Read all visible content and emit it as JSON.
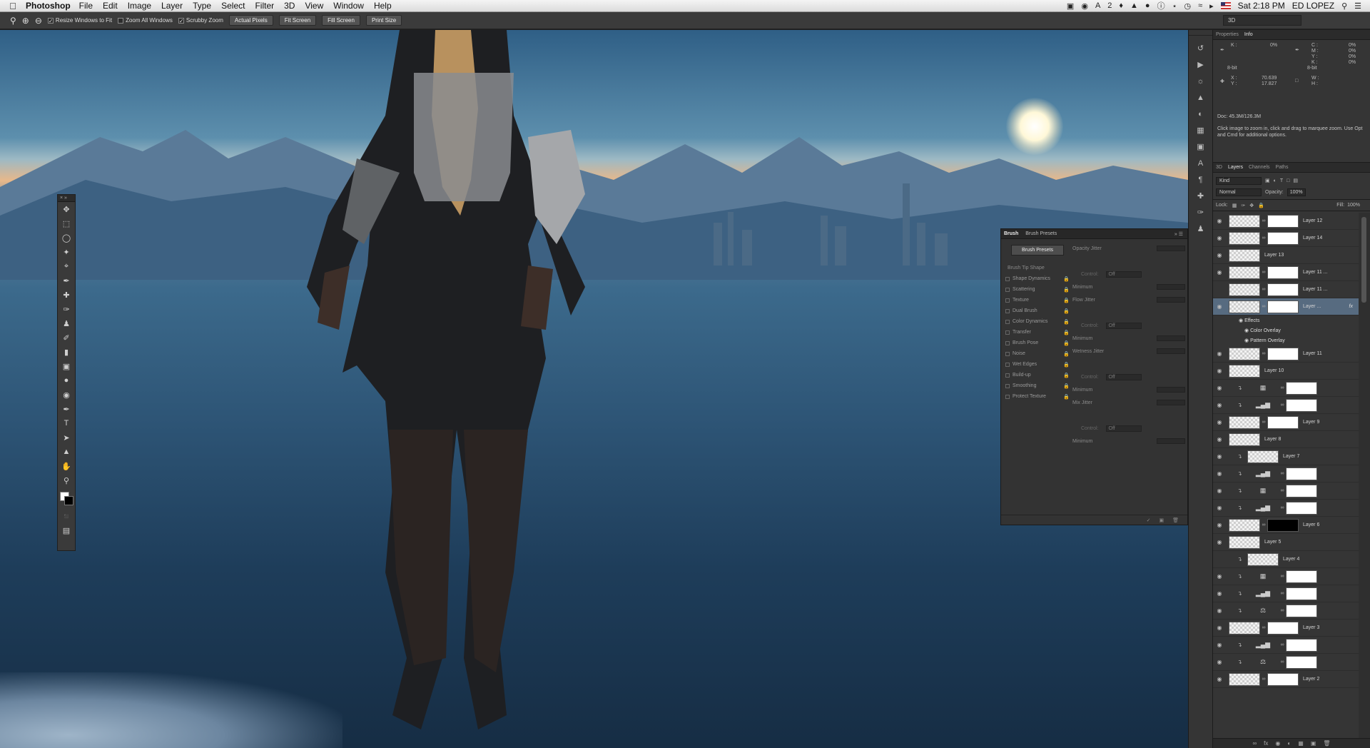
{
  "menubar": {
    "app_name": "Photoshop",
    "items": [
      "File",
      "Edit",
      "Image",
      "Layer",
      "Type",
      "Select",
      "Filter",
      "3D",
      "View",
      "Window",
      "Help"
    ],
    "status_number": "2",
    "clock": "Sat 2:18 PM",
    "user": "ED LOPEZ"
  },
  "options_bar": {
    "resize_windows": "Resize Windows to Fit",
    "zoom_all": "Zoom All Windows",
    "scrubby_zoom": "Scrubby Zoom",
    "actual_pixels": "Actual Pixels",
    "fit_screen": "Fit Screen",
    "fill_screen": "Fill Screen",
    "print_size": "Print Size",
    "workspace": "3D"
  },
  "brush_panel": {
    "tab_brush": "Brush",
    "tab_presets": "Brush Presets",
    "presets_button": "Brush Presets",
    "tip_shape": "Brush Tip Shape",
    "options": [
      "Shape Dynamics",
      "Scattering",
      "Texture",
      "Dual Brush",
      "Color Dynamics",
      "Transfer",
      "Brush Pose",
      "Noise",
      "Wet Edges",
      "Build-up",
      "Smoothing",
      "Protect Texture"
    ],
    "opacity_jitter": "Opacity Jitter",
    "flow_jitter": "Flow Jitter",
    "wetness_jitter": "Wetness Jitter",
    "mix_jitter": "Mix Jitter",
    "control": "Control:",
    "off": "Off",
    "minimum": "Minimum"
  },
  "info_panel": {
    "tab_properties": "Properties",
    "tab_info": "Info",
    "k_label": "K :",
    "k_value": "0%",
    "c": "C :",
    "m": "M :",
    "y": "Y :",
    "k2": "K :",
    "c_val": "0%",
    "m_val": "0%",
    "y_val": "0%",
    "k2_val": "0%",
    "bit_left": "8-bit",
    "bit_right": "8-bit",
    "x_label": "X :",
    "y_label": "Y :",
    "x_value": "70.639",
    "y_value": "17.827",
    "w_label": "W :",
    "h_label": "H :",
    "doc": "Doc: 45.3M/126.3M",
    "note": "Click image to zoom in, click and drag to marquee zoom.  Use Opt and Cmd for additional options."
  },
  "layers_panel": {
    "tab_3d": "3D",
    "tab_layers": "Layers",
    "tab_channels": "Channels",
    "tab_paths": "Paths",
    "kind": "Kind",
    "blend_mode": "Normal",
    "opacity_label": "Opacity:",
    "opacity_value": "100%",
    "lock_label": "Lock:",
    "fill_label": "Fill:",
    "fill_value": "100%",
    "layers": [
      "Layer 12",
      "Layer 14",
      "Layer 13",
      "Layer 11 ...",
      "Layer 11 ...",
      "Layer ...",
      "Effects",
      "Color Overlay",
      "Pattern Overlay",
      "Layer 11",
      "Layer 10",
      "",
      "",
      "Layer 9",
      "Layer 8",
      "Layer 7",
      "",
      "",
      "",
      "Layer 6",
      "Layer 5",
      "Layer 4",
      "",
      "",
      "",
      "Layer 3",
      "",
      "",
      "Layer 2"
    ]
  },
  "colors": {
    "panel_bg": "#353535",
    "selected_layer": "#576b80",
    "menubar_bg": "#e8e8e8"
  }
}
